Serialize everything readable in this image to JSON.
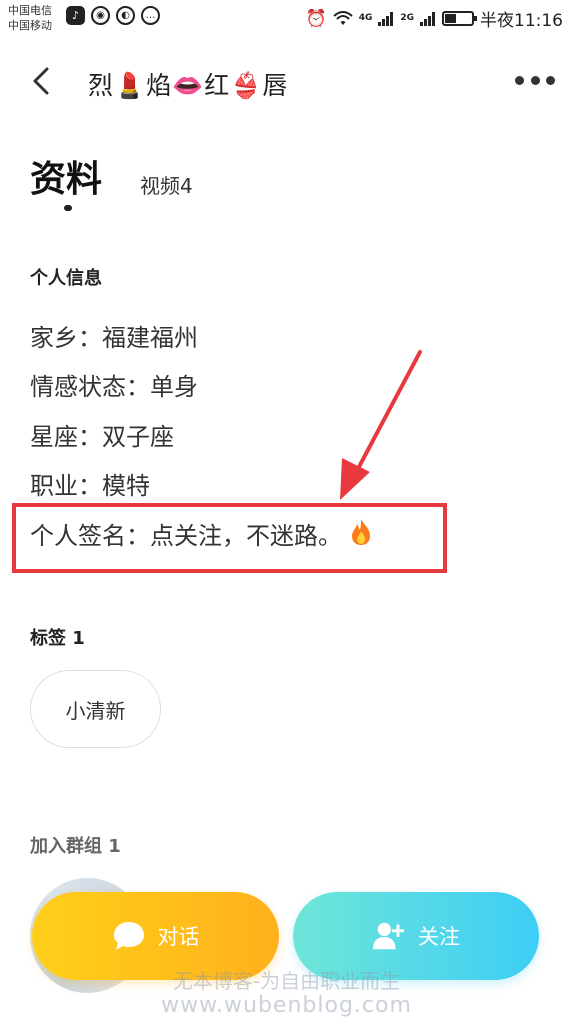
{
  "status_bar": {
    "carrier_1": "中国电信",
    "carrier_2": "中国移动",
    "network_1": "4G",
    "network_2": "2G",
    "time": "半夜11:16",
    "battery_level": 0.4
  },
  "header": {
    "title": "烈💄焰👄红👙唇"
  },
  "tabs": {
    "profile": "资料",
    "videos": "视频4"
  },
  "personal_info": {
    "title": "个人信息",
    "hometown": "家乡：福建福州",
    "relationship": "情感状态：单身",
    "zodiac": "星座：双子座",
    "occupation": "职业：模特",
    "signature": "个人签名：点关注，不迷路。"
  },
  "tags": {
    "title": "标签 1",
    "items": [
      "小清新"
    ]
  },
  "groups": {
    "title": "加入群组 1"
  },
  "actions": {
    "chat_label": "对话",
    "follow_label": "关注"
  },
  "watermark": {
    "line1": "无本博客-为自由职业而生",
    "line2": "www.wubenblog.com"
  },
  "colors": {
    "highlight": "#e83a3e",
    "chat_button": "#ffbf1a",
    "follow_button": "#4fd6ea"
  }
}
